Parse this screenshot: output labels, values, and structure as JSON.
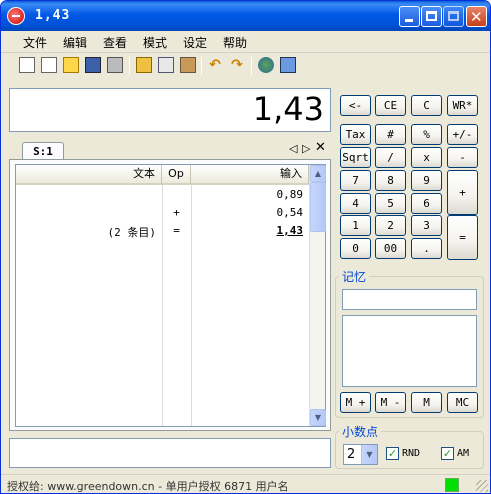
{
  "window": {
    "title": "1,43"
  },
  "menu": [
    "文件",
    "编辑",
    "查看",
    "模式",
    "设定",
    "帮助"
  ],
  "display": {
    "value": "1,43"
  },
  "tape": {
    "tab_label": "S:1",
    "columns": {
      "text": "文本",
      "op": "Op",
      "input": "输入"
    },
    "rows": [
      {
        "text": "",
        "op": "",
        "input": "0,89",
        "total": false
      },
      {
        "text": "",
        "op": "+",
        "input": "0,54",
        "total": false
      },
      {
        "text": "(2 条目)",
        "op": "=",
        "input": "1,43",
        "total": true
      }
    ]
  },
  "keypad": {
    "row1": [
      "<-",
      "CE",
      "C",
      "WR*"
    ],
    "row2": [
      "Tax",
      "#",
      "%",
      "+/-"
    ],
    "row3": [
      "Sqrt",
      "/",
      "x",
      "-"
    ],
    "row4": [
      "7",
      "8",
      "9",
      "+"
    ],
    "row5": [
      "4",
      "5",
      "6"
    ],
    "row6": [
      "1",
      "2",
      "3",
      "="
    ],
    "row7": [
      "0",
      "00",
      "."
    ]
  },
  "memory": {
    "title": "记忆",
    "buttons": [
      "M +",
      "M -",
      "M",
      "MC"
    ]
  },
  "decimals": {
    "title": "小数点",
    "selected": "2",
    "rnd_label": "RND",
    "rnd_checked": true,
    "am_label": "AM",
    "am_checked": true
  },
  "status": {
    "text": "授权给: www.greendown.cn - 单用户授权 6871 用户名"
  },
  "icons": [
    "new-icon",
    "blank-icon",
    "open-icon",
    "save-icon",
    "print-icon",
    "folder-icon",
    "copy-icon",
    "paste-icon",
    "undo-icon",
    "redo-icon",
    "users-icon",
    "book-icon"
  ]
}
